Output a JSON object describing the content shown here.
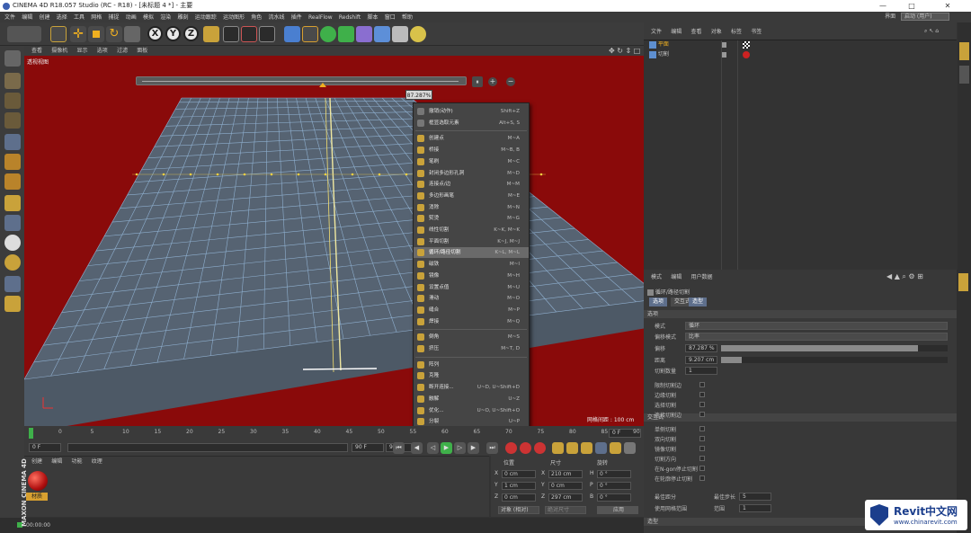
{
  "window": {
    "title": "CINEMA 4D R18.057 Studio (RC - R18) - [未标题 4 *] - 主要",
    "controls": [
      "—",
      "□",
      "✕"
    ]
  },
  "menubar": [
    "文件",
    "编辑",
    "创建",
    "选择",
    "工具",
    "网格",
    "捕捉",
    "动画",
    "模拟",
    "渲染",
    "雕刻",
    "运动跟踪",
    "运动图形",
    "角色",
    "流水线",
    "插件",
    "RealFlow",
    "Redshift",
    "脚本",
    "窗口",
    "帮助"
  ],
  "layout": {
    "label": "界面",
    "value": "启动 (用户)"
  },
  "viewport": {
    "menu": [
      "查看",
      "摄像机",
      "显示",
      "选项",
      "过滤",
      "面板"
    ],
    "title": "透视视图",
    "slider_value": "87.287%",
    "slider_fraction": 0.57,
    "grid_info": "网格间距 : 100 cm",
    "background": "#8a0a0a"
  },
  "context_menu": {
    "items": [
      {
        "label": "撤销(动作)",
        "shortcut": "Shift+Z",
        "color": "#777"
      },
      {
        "label": "框显选取元素",
        "shortcut": "Alt+S, S",
        "color": "#777"
      },
      {
        "sep": true
      },
      {
        "label": "创建点",
        "shortcut": "M~A",
        "color": "#c9a23a"
      },
      {
        "label": "桥接",
        "shortcut": "M~B, B",
        "color": "#c9a23a"
      },
      {
        "label": "笔刷",
        "shortcut": "M~C",
        "color": "#c9a23a"
      },
      {
        "label": "封闭多边形孔洞",
        "shortcut": "M~D",
        "color": "#c9a23a"
      },
      {
        "label": "连接点/边",
        "shortcut": "M~M",
        "color": "#c9a23a"
      },
      {
        "label": "多边形画笔",
        "shortcut": "M~E",
        "color": "#c9a23a"
      },
      {
        "label": "消除",
        "shortcut": "M~N",
        "color": "#c9a23a"
      },
      {
        "label": "熨烫",
        "shortcut": "M~G",
        "color": "#c9a23a"
      },
      {
        "label": "线性切割",
        "shortcut": "K~K, M~K",
        "color": "#c9a23a"
      },
      {
        "label": "平面切割",
        "shortcut": "K~J, M~J",
        "color": "#c9a23a"
      },
      {
        "label": "循环/路径切割",
        "shortcut": "K~L, M~L",
        "color": "#c9a23a",
        "highlight": true
      },
      {
        "label": "磁铁",
        "shortcut": "M~I",
        "color": "#c9a23a"
      },
      {
        "label": "镜像",
        "shortcut": "M~H",
        "color": "#c9a23a"
      },
      {
        "label": "设置点值",
        "shortcut": "M~U",
        "color": "#c9a23a"
      },
      {
        "label": "滑动",
        "shortcut": "M~O",
        "color": "#c9a23a"
      },
      {
        "label": "缝合",
        "shortcut": "M~P",
        "color": "#c9a23a"
      },
      {
        "label": "焊接",
        "shortcut": "M~Q",
        "color": "#c9a23a"
      },
      {
        "sep": true
      },
      {
        "label": "倒角",
        "shortcut": "M~S",
        "color": "#c9a23a"
      },
      {
        "label": "挤压",
        "shortcut": "M~T, D",
        "color": "#c9a23a"
      },
      {
        "sep": true
      },
      {
        "label": "阵列",
        "shortcut": "",
        "color": "#c9a23a"
      },
      {
        "label": "克隆",
        "shortcut": "",
        "color": "#c9a23a"
      },
      {
        "label": "断开连接...",
        "shortcut": "U~D, U~Shift+D",
        "color": "#c9a23a"
      },
      {
        "label": "融解",
        "shortcut": "U~Z",
        "color": "#c9a23a"
      },
      {
        "label": "优化...",
        "shortcut": "U~O, U~Shift+O",
        "color": "#c9a23a"
      },
      {
        "label": "分裂",
        "shortcut": "U~P",
        "color": "#c9a23a"
      }
    ]
  },
  "timeline": {
    "ticks": [
      "0",
      "5",
      "10",
      "15",
      "20",
      "25",
      "30",
      "35",
      "40",
      "45",
      "50",
      "55",
      "60",
      "65",
      "70",
      "75",
      "80",
      "85",
      "90"
    ],
    "current": "0 F",
    "start": "0 F",
    "end": "90 F",
    "end2": "90 F"
  },
  "material_panel": {
    "menu": [
      "创建",
      "编辑",
      "功能",
      "纹理"
    ],
    "material_name": "材质"
  },
  "coords": {
    "headers": [
      "位置",
      "尺寸",
      "旋转"
    ],
    "rows": [
      {
        "a": "X",
        "pos": "0 cm",
        "s": "X",
        "size": "210 cm",
        "r": "H",
        "rot": "0 °"
      },
      {
        "a": "Y",
        "pos": "1 cm",
        "s": "Y",
        "size": "0 cm",
        "r": "P",
        "rot": "0 °"
      },
      {
        "a": "Z",
        "pos": "0 cm",
        "s": "Z",
        "size": "297 cm",
        "r": "B",
        "rot": "0 °"
      }
    ],
    "mode": "对象 (相对)",
    "size_mode": "绝对尺寸",
    "apply": "应用"
  },
  "object_manager": {
    "menu": [
      "文件",
      "编辑",
      "查看",
      "对象",
      "标签",
      "书签"
    ],
    "objects": [
      {
        "name": "平面"
      },
      {
        "name": "切割"
      }
    ]
  },
  "attributes": {
    "menu": [
      "模式",
      "编辑",
      "用户数据"
    ],
    "tool_name": "循环/路径切割",
    "tabs": [
      "选项",
      "交互式",
      "造型"
    ],
    "section1": "选项",
    "rows": [
      {
        "label": "模式",
        "value": "循环"
      },
      {
        "label": "偏移模式",
        "value": "比率"
      },
      {
        "label": "偏移",
        "value": "87.287 %",
        "fill": 0.87
      },
      {
        "label": "距离",
        "value": "9.207 cm",
        "fill": 0.09
      },
      {
        "label": "切割数量",
        "value": "1"
      }
    ],
    "checks1": [
      "限制切割边",
      "边缘切割",
      "选择切割",
      "连接切割边"
    ],
    "section2": "交互式",
    "checks2": [
      "单侧切割",
      "双向切割",
      "镜像切割",
      "切割方向",
      "在N-gon停止切割",
      "在轮廓停止切割"
    ],
    "extra": [
      {
        "label": "最佳距分",
        "value": "",
        "label2": "最佳步长",
        "value2": "5"
      },
      {
        "label": "使用网格范围",
        "value": "",
        "label2": "范围",
        "value2": "1"
      }
    ],
    "section3": "造型"
  },
  "status": {
    "time": "00:00:00"
  },
  "brand": {
    "maxon": "MAXON CINEMA 4D",
    "watermark_title": "Revit中文网",
    "watermark_url": "www.chinarevit.com"
  }
}
